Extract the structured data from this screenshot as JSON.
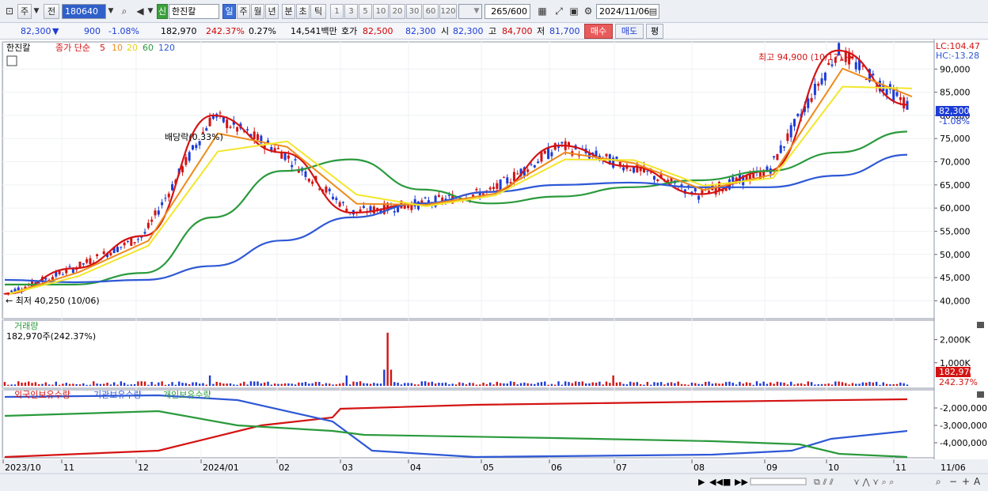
{
  "toolbar": {
    "icons": [
      "window-icon",
      "dropdown-icon",
      "search-icon",
      "speaker-icon",
      "grid-icon",
      "draw-icon",
      "save-icon",
      "settings-icon",
      "calendar-icon"
    ],
    "mode": "주",
    "prev": "전",
    "code": "180640",
    "badge": "신",
    "name": "한진칼",
    "periods": [
      "일",
      "주",
      "월",
      "년",
      "분",
      "초",
      "틱"
    ],
    "active_period": "일",
    "intervals": [
      "1",
      "3",
      "5",
      "10",
      "20",
      "30",
      "60",
      "120"
    ],
    "count": "265",
    "count_total": "/600",
    "date": "2024/11/06"
  },
  "info": {
    "price": "82,300",
    "direction": "▼",
    "change": "900",
    "change_pct": "-1.08%",
    "volume": "182,970",
    "volume_pct": "242.37%",
    "turnover": "0.27%",
    "amount": "14,541백만",
    "quote_label": "호가",
    "ask": "82,500",
    "bid": "82,300",
    "open_label": "시",
    "open": "82,300",
    "high_label": "고",
    "high": "84,700",
    "low_label": "저",
    "low": "81,700",
    "buy": "매수",
    "sell": "매도",
    "eval": "평"
  },
  "price_panel": {
    "stock_label": "한진칼",
    "indicator_label": "종가 단순",
    "ma_periods": [
      "5",
      "10",
      "20",
      "60",
      "120"
    ],
    "ma_colors": [
      "#d41313",
      "#ee8a1c",
      "#f3e62a",
      "#2a9a3c",
      "#2e58d6"
    ],
    "lc": "LC:104.47",
    "hc": "HC:-13.28",
    "current": "82,300",
    "current_pct": "-1.08%",
    "high_note": "최고 94,900 (10/17) →",
    "low_note": "← 최저 40,250 (10/06)",
    "dividend_note": "배당락(0.33%)",
    "y_ticks": [
      "90,000",
      "85,000",
      "80,000",
      "75,000",
      "70,000",
      "65,000",
      "60,000",
      "55,000",
      "50,000",
      "45,000",
      "40,000"
    ]
  },
  "volume_panel": {
    "title": "거래량",
    "summary": "182,970주(242.37%)",
    "y_ticks": [
      "2,000K",
      "1,000K"
    ],
    "current": "182,970",
    "current_pct": "242.37%"
  },
  "holdings_panel": {
    "series": [
      "외국인보유수량",
      "기관보유수량",
      "개인보유수량"
    ],
    "colors": [
      "#d41313",
      "#2e58d6",
      "#2a9a3c"
    ],
    "y_ticks": [
      "-2,000,000",
      "-3,000,000",
      "-4,000,000"
    ]
  },
  "x_axis": {
    "labels": [
      "2023/10",
      "11",
      "12",
      "2024/01",
      "02",
      "03",
      "04",
      "05",
      "06",
      "07",
      "08",
      "09",
      "10",
      "11",
      "11/06"
    ]
  },
  "chart_data": {
    "type": "line",
    "x": [
      "2023-10",
      "2023-11",
      "2023-12",
      "2024-01",
      "2024-02",
      "2024-03",
      "2024-04",
      "2024-05",
      "2024-06",
      "2024-07",
      "2024-08",
      "2024-09",
      "2024-10",
      "2024-11"
    ],
    "series": [
      {
        "name": "5",
        "values": [
          41500,
          47000,
          54000,
          80000,
          72000,
          59000,
          61000,
          63500,
          73500,
          69000,
          63000,
          68000,
          94000,
          82300
        ]
      },
      {
        "name": "60",
        "values": [
          43500,
          43500,
          46000,
          58000,
          68000,
          70500,
          64000,
          61000,
          62500,
          64500,
          66000,
          68000,
          72000,
          76500
        ]
      },
      {
        "name": "120",
        "values": [
          44500,
          44000,
          44500,
          47500,
          53000,
          58000,
          61000,
          63500,
          65000,
          65500,
          64500,
          64500,
          67000,
          71500
        ]
      }
    ],
    "volume_peak": "약 2,300K (2024/03 초)",
    "ylim": [
      37000,
      95000
    ]
  }
}
